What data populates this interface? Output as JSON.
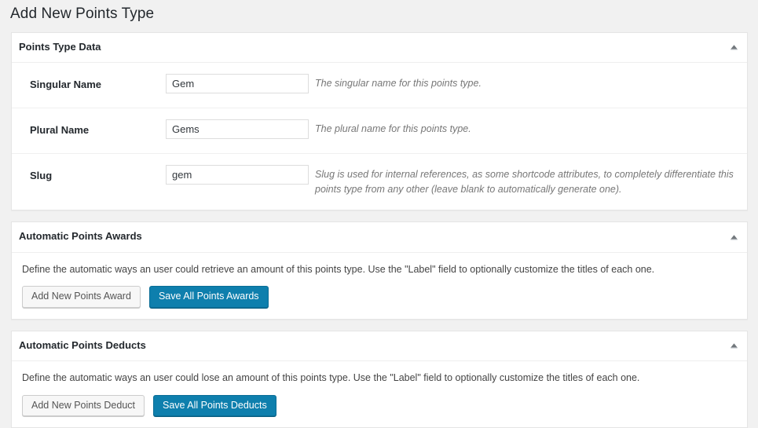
{
  "page": {
    "title": "Add New Points Type"
  },
  "panels": {
    "points_type_data": {
      "title": "Points Type Data",
      "toggle_icon": "chevron-up-icon",
      "fields": [
        {
          "label": "Singular Name",
          "value": "Gem",
          "placeholder": "",
          "description": "The singular name for this points type."
        },
        {
          "label": "Plural Name",
          "value": "Gems",
          "placeholder": "",
          "description": "The plural name for this points type."
        },
        {
          "label": "Slug",
          "value": "gem",
          "placeholder": "",
          "description": "Slug is used for internal references, as some shortcode attributes, to completely differentiate this points type from any other (leave blank to automatically generate one)."
        }
      ]
    },
    "automatic_points_awards": {
      "title": "Automatic Points Awards",
      "toggle_icon": "chevron-up-icon",
      "intro": "Define the automatic ways an user could retrieve an amount of this points type. Use the \"Label\" field to optionally customize the titles of each one.",
      "add_button": "Add New Points Award",
      "save_button": "Save All Points Awards"
    },
    "automatic_points_deducts": {
      "title": "Automatic Points Deducts",
      "toggle_icon": "chevron-up-icon",
      "intro": "Define the automatic ways an user could lose an amount of this points type. Use the \"Label\" field to optionally customize the titles of each one.",
      "add_button": "Add New Points Deduct",
      "save_button": "Save All Points Deducts"
    }
  },
  "colors": {
    "page_background": "#f1f1f1",
    "panel_background": "#ffffff",
    "primary_button": "#0e7fad",
    "title_text": "#23282d",
    "description_text": "#777777"
  }
}
